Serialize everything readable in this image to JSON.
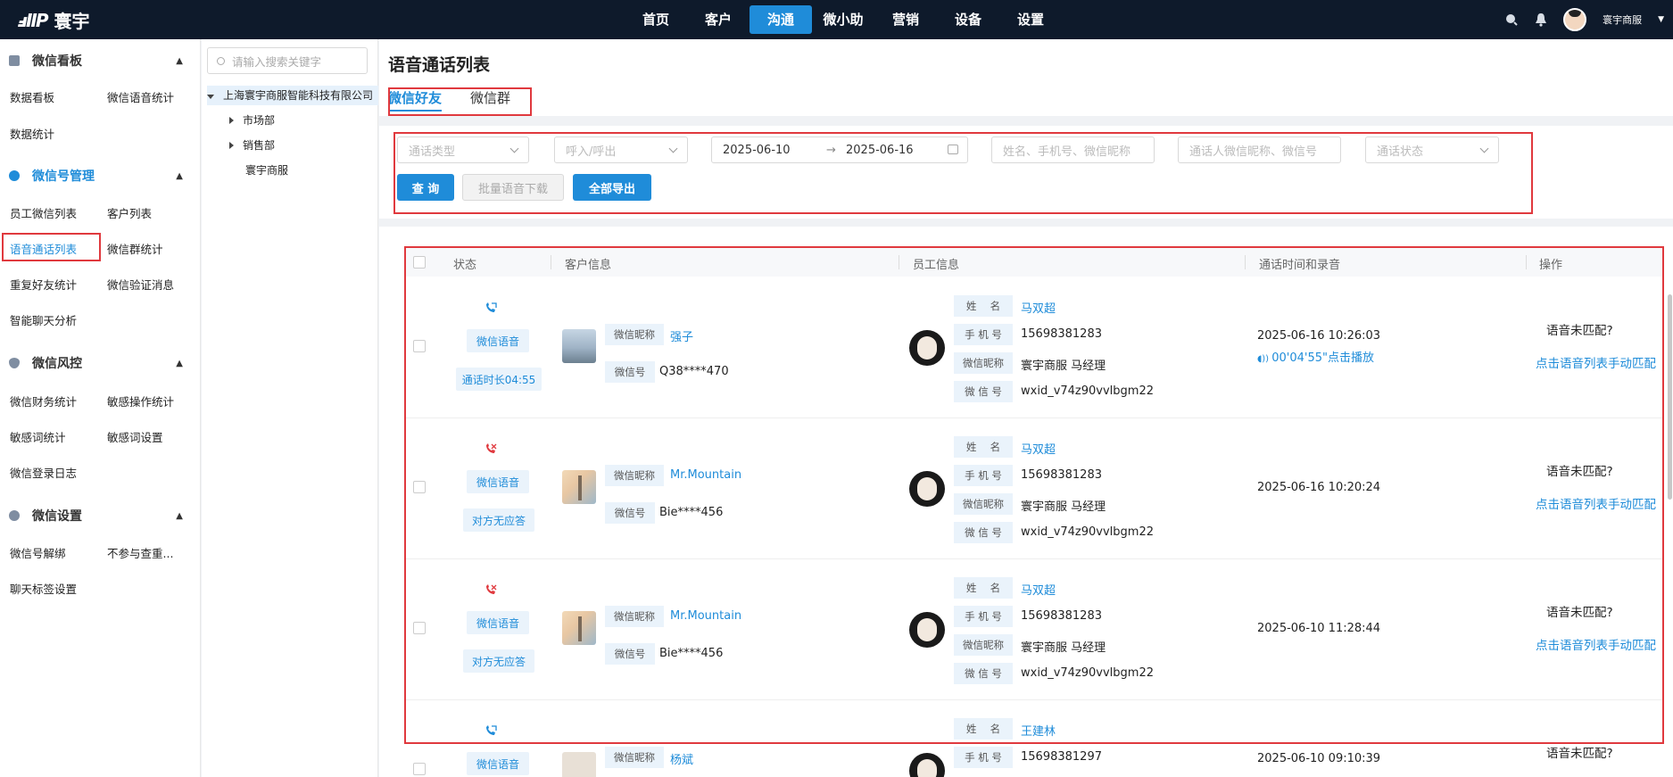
{
  "topbar": {
    "logo_mark": "ⅎIIP",
    "logo_text": "寰宇",
    "nav": [
      "首页",
      "客户",
      "沟通",
      "微小助",
      "营销",
      "设备",
      "设置"
    ],
    "active_nav": "沟通",
    "user_name": "寰宇商服"
  },
  "sidebar": {
    "sections": [
      {
        "title": "微信看板",
        "items": [
          "数据看板",
          "微信语音统计",
          "数据统计"
        ]
      },
      {
        "title": "微信号管理",
        "items": [
          "员工微信列表",
          "客户列表",
          "语音通话列表",
          "微信群统计",
          "重复好友统计",
          "微信验证消息",
          "智能聊天分析"
        ]
      },
      {
        "title": "微信风控",
        "items": [
          "微信财务统计",
          "敏感操作统计",
          "敏感词统计",
          "敏感词设置",
          "微信登录日志"
        ]
      },
      {
        "title": "微信设置",
        "items": [
          "微信号解绑",
          "不参与查重...",
          "聊天标签设置"
        ]
      }
    ],
    "active_item": "语音通话列表"
  },
  "tree": {
    "search_placeholder": "请输入搜索关键字",
    "root": "上海寰宇商服智能科技有限公司",
    "children": [
      "市场部",
      "销售部",
      "寰宇商服"
    ]
  },
  "page": {
    "title": "语音通话列表",
    "tabs": [
      "微信好友",
      "微信群"
    ],
    "active_tab": "微信好友"
  },
  "filters": {
    "call_type_placeholder": "通话类型",
    "direction_placeholder": "呼入/呼出",
    "date_from": "2025-06-10",
    "date_arrow": "→",
    "date_to": "2025-06-16",
    "keyword_placeholder": "姓名、手机号、微信昵称",
    "peer_placeholder": "通话人微信昵称、微信号",
    "status_placeholder": "通话状态",
    "query_btn": "查 询",
    "batch_download_btn": "批量语音下载",
    "export_btn": "全部导出"
  },
  "table": {
    "headers": [
      "状态",
      "客户信息",
      "员工信息",
      "通话时间和录音",
      "操作"
    ],
    "labels": {
      "nickname": "微信昵称",
      "wxid": "微信号",
      "name": "姓　 名",
      "phone": "手 机 号",
      "emp_nickname": "微信昵称",
      "emp_wxid": "微 信 号"
    },
    "rows": [
      {
        "call_type": "微信语音",
        "status": "通话时长04:55",
        "customer_nickname": "强子",
        "customer_wxid": "Q38****470",
        "emp_name": "马双超",
        "emp_phone": "15698381283",
        "emp_nickname": "寰宇商服 马经理",
        "emp_wxid": "wxid_v74z90vvlbgm22",
        "time": "2025-06-16 10:26:03",
        "recording": "00'04'55\"点击播放",
        "op_status": "语音未匹配?",
        "op_link": "点击语音列表手动匹配",
        "icon_color": "#1f8cd9"
      },
      {
        "call_type": "微信语音",
        "status": "对方无应答",
        "customer_nickname": "Mr.Mountain",
        "customer_wxid": "Bie****456",
        "emp_name": "马双超",
        "emp_phone": "15698381283",
        "emp_nickname": "寰宇商服 马经理",
        "emp_wxid": "wxid_v74z90vvlbgm22",
        "time": "2025-06-16 10:20:24",
        "recording": "",
        "op_status": "语音未匹配?",
        "op_link": "点击语音列表手动匹配",
        "icon_color": "#e0393e"
      },
      {
        "call_type": "微信语音",
        "status": "对方无应答",
        "customer_nickname": "Mr.Mountain",
        "customer_wxid": "Bie****456",
        "emp_name": "马双超",
        "emp_phone": "15698381283",
        "emp_nickname": "寰宇商服 马经理",
        "emp_wxid": "wxid_v74z90vvlbgm22",
        "time": "2025-06-10 11:28:44",
        "recording": "",
        "op_status": "语音未匹配?",
        "op_link": "点击语音列表手动匹配",
        "icon_color": "#e0393e"
      },
      {
        "call_type": "微信语音",
        "status": "",
        "customer_nickname": "杨斌",
        "customer_wxid": "",
        "emp_name": "王建林",
        "emp_phone": "15698381297",
        "emp_nickname": "",
        "emp_wxid": "",
        "time": "2025-06-10 09:10:39",
        "recording": "",
        "op_status": "语音未匹配?",
        "op_link": "",
        "icon_color": "#1f8cd9"
      }
    ]
  },
  "colors": {
    "accent": "#1f8cd9",
    "highlight_box": "#e0393e",
    "topbar": "#0e1a2b"
  }
}
